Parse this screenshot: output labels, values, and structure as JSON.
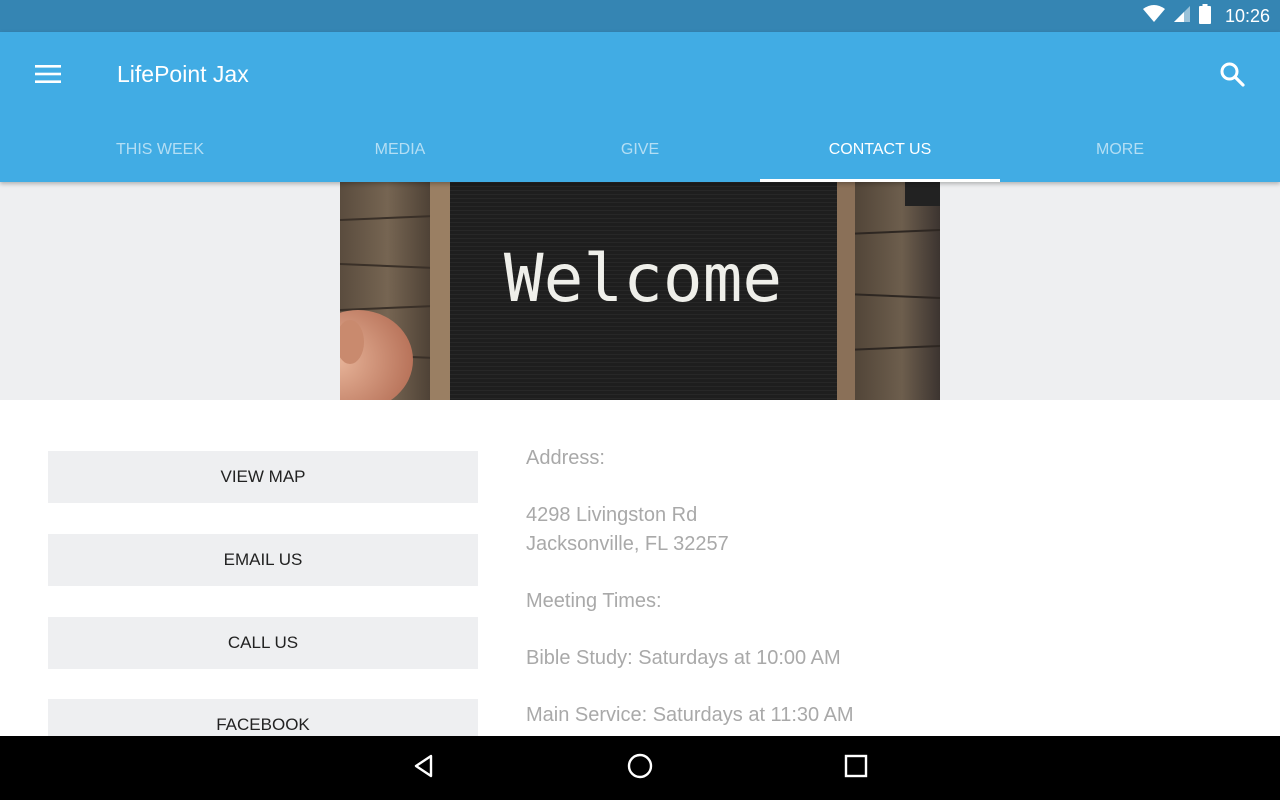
{
  "status_bar": {
    "time": "10:26",
    "icons": [
      "wifi-icon",
      "signal-icon",
      "battery-icon"
    ]
  },
  "app_bar": {
    "title": "LifePoint Jax",
    "menu_icon": "hamburger-menu-icon",
    "search_icon": "search-icon",
    "color": "#41ace4"
  },
  "tabs": [
    {
      "label": "THIS WEEK",
      "active": false
    },
    {
      "label": "MEDIA",
      "active": false
    },
    {
      "label": "GIVE",
      "active": false
    },
    {
      "label": "CONTACT US",
      "active": true
    },
    {
      "label": "MORE",
      "active": false
    }
  ],
  "banner": {
    "text": "Welcome"
  },
  "buttons": [
    {
      "label": "VIEW MAP"
    },
    {
      "label": "EMAIL US"
    },
    {
      "label": "CALL US"
    },
    {
      "label": "FACEBOOK"
    }
  ],
  "info": {
    "address_heading": "Address:",
    "address_line1": "4298 Livingston Rd",
    "address_line2": "Jacksonville, FL 32257",
    "meeting_heading": "Meeting Times:",
    "bible_study": "Bible Study: Saturdays at 10:00 AM",
    "main_service": "Main Service: Saturdays at 11:30 AM"
  },
  "nav_bar": {
    "icons": [
      "back-icon",
      "home-icon",
      "recents-icon"
    ]
  }
}
